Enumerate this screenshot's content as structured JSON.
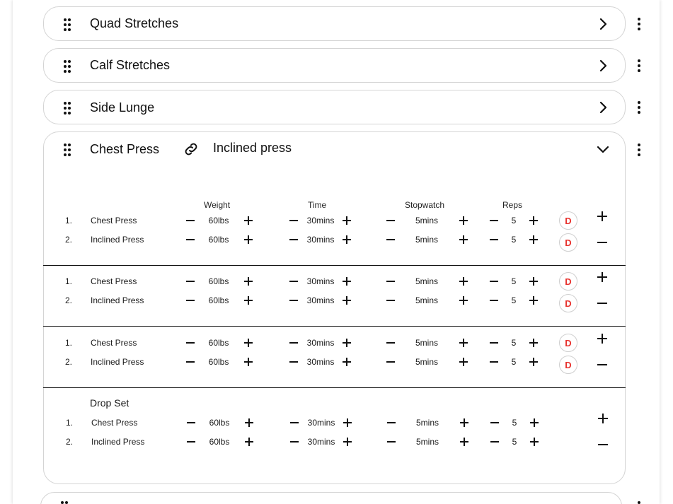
{
  "exercises_collapsed": [
    {
      "title": "Quad Stretches"
    },
    {
      "title": "Calf Stretches"
    },
    {
      "title": "Side Lunge"
    }
  ],
  "expanded": {
    "title": "Chest Press",
    "linked_title": "Inclined press",
    "columns": [
      "Weight",
      "Time",
      "Stopwatch",
      "Reps"
    ],
    "drop_set_label": "Drop Set",
    "badge_letter": "D",
    "sets": [
      {
        "rows": [
          {
            "num": "1.",
            "name": "Chest Press",
            "weight": "60lbs",
            "time": "30mins",
            "stopwatch": "5mins",
            "reps": "5"
          },
          {
            "num": "2.",
            "name": "Inclined Press",
            "weight": "60lbs",
            "time": "30mins",
            "stopwatch": "5mins",
            "reps": "5"
          }
        ]
      },
      {
        "rows": [
          {
            "num": "1.",
            "name": "Chest Press",
            "weight": "60lbs",
            "time": "30mins",
            "stopwatch": "5mins",
            "reps": "5"
          },
          {
            "num": "2.",
            "name": "Inclined Press",
            "weight": "60lbs",
            "time": "30mins",
            "stopwatch": "5mins",
            "reps": "5"
          }
        ]
      },
      {
        "rows": [
          {
            "num": "1.",
            "name": "Chest Press",
            "weight": "60lbs",
            "time": "30mins",
            "stopwatch": "5mins",
            "reps": "5"
          },
          {
            "num": "2.",
            "name": "Inclined Press",
            "weight": "60lbs",
            "time": "30mins",
            "stopwatch": "5mins",
            "reps": "5"
          }
        ]
      },
      {
        "rows": [
          {
            "num": "1.",
            "name": "Chest Press",
            "weight": "60lbs",
            "time": "30mins",
            "stopwatch": "5mins",
            "reps": "5"
          },
          {
            "num": "2.",
            "name": "Inclined Press",
            "weight": "60lbs",
            "time": "30mins",
            "stopwatch": "5mins",
            "reps": "5"
          }
        ]
      }
    ]
  },
  "icons": {
    "drag": "drag-handle-icon",
    "expand": "chevron-right-icon",
    "collapse": "chevron-down-icon",
    "more": "more-vertical-icon",
    "link": "link-icon",
    "decrement": "minus-icon",
    "increment": "plus-icon"
  },
  "colors": {
    "badge": "#e8332f",
    "border": "#d4d4d4"
  }
}
